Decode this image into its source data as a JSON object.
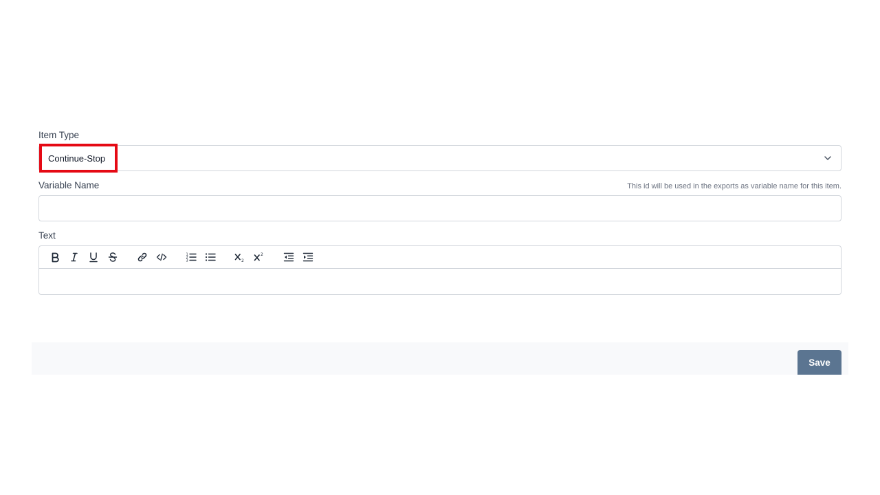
{
  "item_type": {
    "label": "Item Type",
    "selected_value": "Continue-Stop"
  },
  "variable_name": {
    "label": "Variable Name",
    "hint": "This id will be used in the exports as variable name for this item.",
    "value": "",
    "placeholder": ""
  },
  "text_field": {
    "label": "Text",
    "toolbar": [
      {
        "name": "bold-icon"
      },
      {
        "name": "italic-icon"
      },
      {
        "name": "underline-icon"
      },
      {
        "name": "strikethrough-icon"
      },
      {
        "name": "link-icon"
      },
      {
        "name": "code-icon"
      },
      {
        "name": "ordered-list-icon"
      },
      {
        "name": "bullet-list-icon"
      },
      {
        "name": "subscript-icon"
      },
      {
        "name": "superscript-icon"
      },
      {
        "name": "outdent-icon"
      },
      {
        "name": "indent-icon"
      }
    ],
    "value": ""
  },
  "footer": {
    "save_label": "Save"
  },
  "colors": {
    "highlight": "#e50914",
    "save_button": "#5b7591",
    "footer_bg": "#f8f9fb",
    "border": "#d1d5db"
  }
}
